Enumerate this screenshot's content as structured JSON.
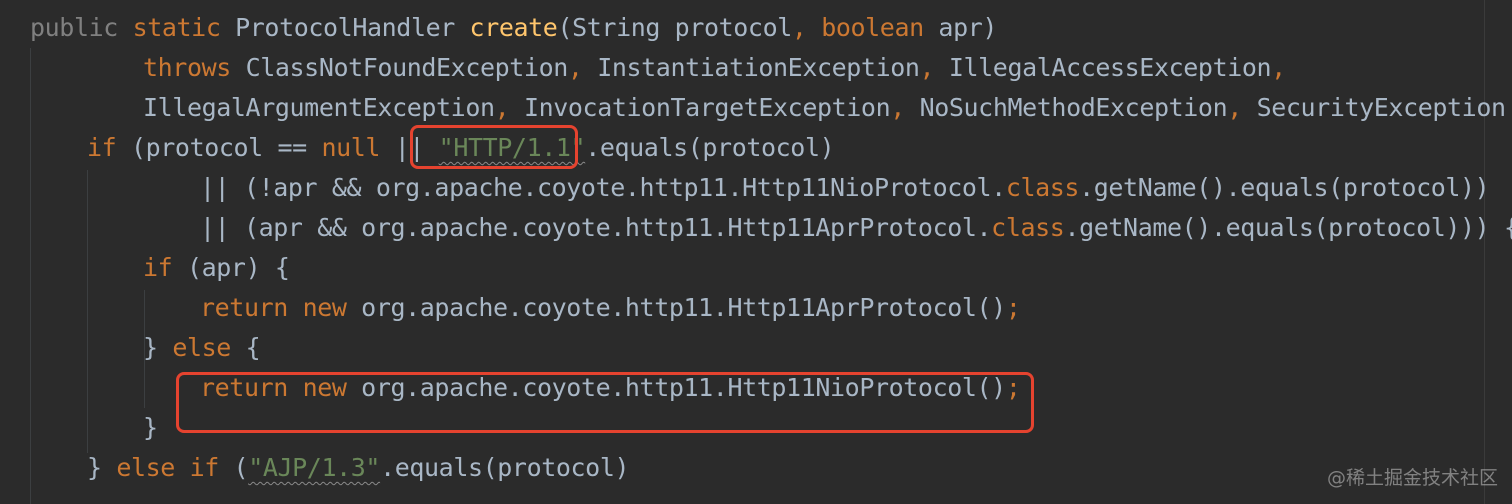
{
  "editor": {
    "lines": [
      [
        [
          "public ",
          "dim"
        ],
        [
          "static ",
          "kw"
        ],
        [
          "ProtocolHandler ",
          "plain"
        ],
        [
          "create",
          "fn"
        ],
        [
          "(String protocol",
          "plain"
        ],
        [
          ", ",
          "kw"
        ],
        [
          "boolean ",
          "kw"
        ],
        [
          "apr)",
          "plain"
        ]
      ],
      [
        [
          "throws ",
          "kw"
        ],
        [
          "ClassNotFoundException",
          "plain"
        ],
        [
          ", ",
          "kw"
        ],
        [
          "InstantiationException",
          "plain"
        ],
        [
          ", ",
          "kw"
        ],
        [
          "IllegalAccessException",
          "plain"
        ],
        [
          ",",
          "kw"
        ]
      ],
      [
        [
          "IllegalArgumentException",
          "plain"
        ],
        [
          ", ",
          "kw"
        ],
        [
          "InvocationTargetException",
          "plain"
        ],
        [
          ", ",
          "kw"
        ],
        [
          "NoSuchMethodException",
          "plain"
        ],
        [
          ", ",
          "kw"
        ],
        [
          "SecurityException {",
          "plain"
        ]
      ],
      [
        [
          "if ",
          "kw"
        ],
        [
          "(protocol == ",
          "plain"
        ],
        [
          "null ",
          "kw"
        ],
        [
          "|| ",
          "plain"
        ],
        [
          "\"HTTP/1.1\"",
          "strsq"
        ],
        [
          ".equals(protocol)",
          "plain"
        ]
      ],
      [
        [
          "|| (!apr && org.apache.coyote.http11.Http11NioProtocol.",
          "plain"
        ],
        [
          "class",
          "kw"
        ],
        [
          ".getName().equals(protocol))",
          "plain"
        ]
      ],
      [
        [
          "|| (apr && org.apache.coyote.http11.Http11AprProtocol.",
          "plain"
        ],
        [
          "class",
          "kw"
        ],
        [
          ".getName().equals(protocol))) {",
          "plain"
        ]
      ],
      [
        [
          "if ",
          "kw"
        ],
        [
          "(apr) {",
          "plain"
        ]
      ],
      [
        [
          "return ",
          "kw"
        ],
        [
          "new ",
          "kw"
        ],
        [
          "org.apache.coyote.http11.Http11AprProtocol()",
          "plain"
        ],
        [
          ";",
          "kw"
        ]
      ],
      [
        [
          "} ",
          "plain"
        ],
        [
          "else ",
          "kw"
        ],
        [
          "{",
          "plain"
        ]
      ],
      [
        [
          "return ",
          "kw"
        ],
        [
          "new ",
          "kw"
        ],
        [
          "org.apache.coyote.http11.Http11NioProtocol()",
          "plain"
        ],
        [
          ";",
          "kw"
        ]
      ],
      [
        [
          "}",
          "plain"
        ]
      ],
      [
        [
          "} ",
          "plain"
        ],
        [
          "else if ",
          "kw"
        ],
        [
          "(",
          "plain"
        ],
        [
          "\"AJP/1.3\"",
          "strsq"
        ],
        [
          ".equals(protocol)",
          "plain"
        ]
      ]
    ]
  },
  "watermark": "@稀土掘金技术社区",
  "colors": {
    "background": "#2b2b2b",
    "keyword": "#cc7832",
    "method": "#ffc66d",
    "string": "#6a8759",
    "text": "#a9b7c6",
    "highlight_box": "#e5432f"
  }
}
